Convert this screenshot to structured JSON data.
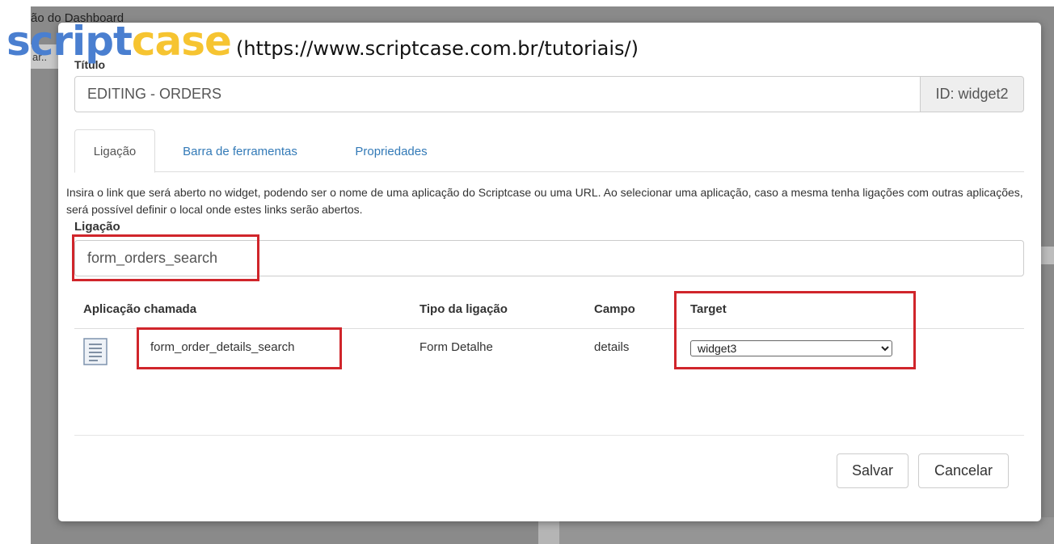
{
  "background": {
    "page_title": "ão do Dashboard",
    "strip_text": "ar.."
  },
  "watermark": {
    "brand_part1": "script",
    "brand_part2": "case",
    "url": "(https://www.scriptcase.com.br/tutoriais/)",
    "colors": {
      "script": "#4a7fd0",
      "case": "#f6c431"
    }
  },
  "modal": {
    "title_label": "Título",
    "title_value": "EDITING - ORDERS",
    "id_addon": "ID: widget2",
    "tabs": [
      {
        "label": "Ligação",
        "active": true
      },
      {
        "label": "Barra de ferramentas",
        "active": false
      },
      {
        "label": "Propriedades",
        "active": false
      }
    ],
    "description": "Insira o link que será aberto no widget, podendo ser o nome de uma aplicação do Scriptcase ou uma URL. Ao selecionar uma aplicação, caso a mesma tenha ligações com outras aplicações, será possível definir o local onde estes links serão abertos.",
    "link_label": "Ligação",
    "link_value": "form_orders_search",
    "table": {
      "headers": [
        "Aplicação chamada",
        "Tipo da ligação",
        "Campo",
        "Target"
      ],
      "rows": [
        {
          "icon": "document-icon",
          "app": "form_order_details_search",
          "type": "Form Detalhe",
          "field": "details",
          "target": "widget3"
        }
      ]
    },
    "buttons": {
      "save": "Salvar",
      "cancel": "Cancelar"
    },
    "highlight_color": "#d0252b"
  }
}
